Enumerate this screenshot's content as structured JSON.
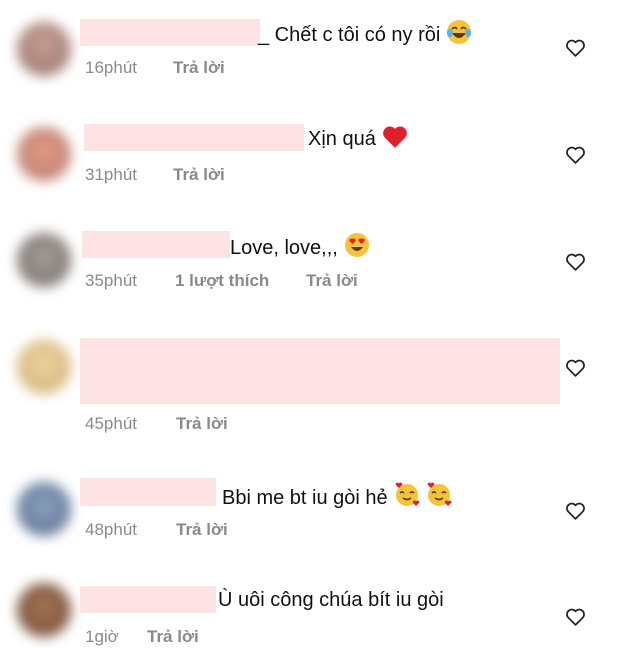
{
  "colors": {
    "redaction": "#fde3e3",
    "meta_text": "#8a8a8a",
    "heart_stroke": "#222222",
    "heart_fill": "#e0202d"
  },
  "comments": [
    {
      "text": "_ Chết c tôi có ny rồi",
      "emoji": "laughing-tears",
      "time": "16phút",
      "likes": "",
      "reply": "Trả lời"
    },
    {
      "text": "Xịn quá",
      "emoji": "red-heart",
      "time": "31phút",
      "likes": "",
      "reply": "Trả lời"
    },
    {
      "text": "Love, love,,,",
      "emoji": "heart-eyes",
      "time": "35phút",
      "likes": "1 lượt thích",
      "reply": "Trả lời"
    },
    {
      "text": "",
      "emoji": "",
      "time": "45phút",
      "likes": "",
      "reply": "Trả lời"
    },
    {
      "text": "Bbi me bt iu gòi hẻ",
      "emoji": "smiling-hearts",
      "time": "48phút",
      "likes": "",
      "reply": "Trả lời"
    },
    {
      "text": "Ù uôi công chúa bít iu gòi",
      "emoji": "",
      "time": "1giờ",
      "likes": "",
      "reply": "Trả lời"
    }
  ]
}
